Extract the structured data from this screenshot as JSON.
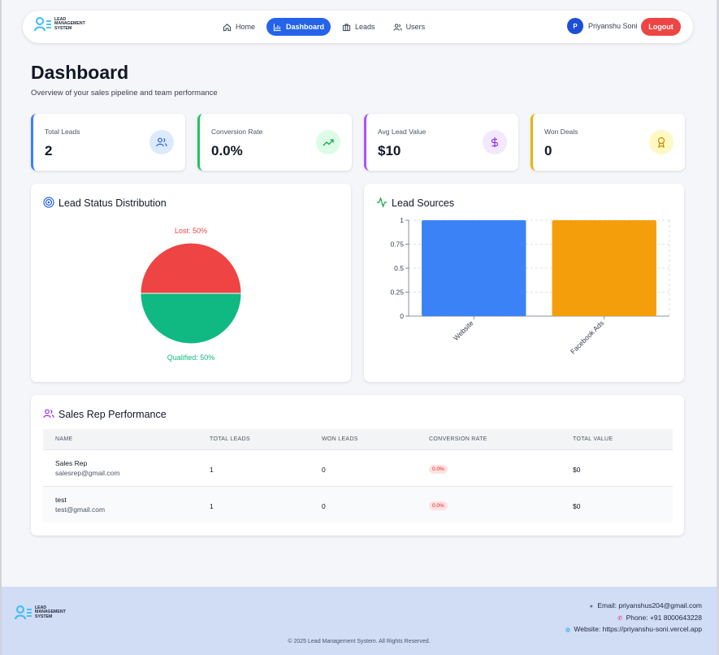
{
  "app": {
    "logo_line1": "LEAD",
    "logo_line2": "MANAGEMENT",
    "logo_line3": "SYSTEM"
  },
  "nav": {
    "items": [
      {
        "label": "Home",
        "icon": "home-icon"
      },
      {
        "label": "Dashboard",
        "icon": "bar-chart-icon",
        "active": true
      },
      {
        "label": "Leads",
        "icon": "briefcase-icon"
      },
      {
        "label": "Users",
        "icon": "users-icon"
      }
    ],
    "user_initial": "P",
    "user_name": "Priyanshu Soni",
    "logout_label": "Logout"
  },
  "header": {
    "title": "Dashboard",
    "subtitle": "Overview of your sales pipeline and team performance"
  },
  "stats": [
    {
      "label": "Total Leads",
      "value": "2",
      "icon": "users-icon",
      "color": "#3b82f6"
    },
    {
      "label": "Conversion Rate",
      "value": "0.0%",
      "icon": "trending-up-icon",
      "color": "#22c55e"
    },
    {
      "label": "Avg Lead Value",
      "value": "$10",
      "icon": "dollar-icon",
      "color": "#a855f7"
    },
    {
      "label": "Won Deals",
      "value": "0",
      "icon": "award-icon",
      "color": "#eab308"
    }
  ],
  "status_panel": {
    "title": "Lead Status Distribution",
    "icon": "target-icon"
  },
  "sources_panel": {
    "title": "Lead Sources",
    "icon": "activity-icon"
  },
  "chart_data": [
    {
      "type": "pie",
      "categories": [
        "Lost",
        "Qualified"
      ],
      "values": [
        50,
        50
      ],
      "labels": [
        "Lost: 50%",
        "Qualified: 50%"
      ],
      "colors": [
        "#ef4444",
        "#10b981"
      ]
    },
    {
      "type": "bar",
      "categories": [
        "Website",
        "Facebook Ads"
      ],
      "values": [
        1,
        1
      ],
      "colors": [
        "#3b82f6",
        "#f59e0b"
      ],
      "ylim": [
        0,
        1
      ],
      "yticks": [
        "0",
        "0.25",
        "0.5",
        "0.75",
        "1"
      ],
      "grid": true
    }
  ],
  "performance": {
    "title": "Sales Rep Performance",
    "icon": "users-icon",
    "columns": [
      "NAME",
      "TOTAL LEADS",
      "WON LEADS",
      "CONVERSION RATE",
      "TOTAL VALUE"
    ],
    "rows": [
      {
        "name": "Sales Rep",
        "email": "salesrep@gmail.com",
        "total_leads": "1",
        "won_leads": "0",
        "conversion": "0.0%",
        "value": "$0"
      },
      {
        "name": "test",
        "email": "test@gmail.com",
        "total_leads": "1",
        "won_leads": "0",
        "conversion": "0.0%",
        "value": "$0"
      }
    ]
  },
  "footer": {
    "email": "Email: priyanshus204@gmail.com",
    "phone": "Phone: +91 8000643228",
    "website": "Website: https://priyanshu-soni.vercel.app",
    "copyright": "© 2025 Lead Management System. All Rights Reserved."
  }
}
